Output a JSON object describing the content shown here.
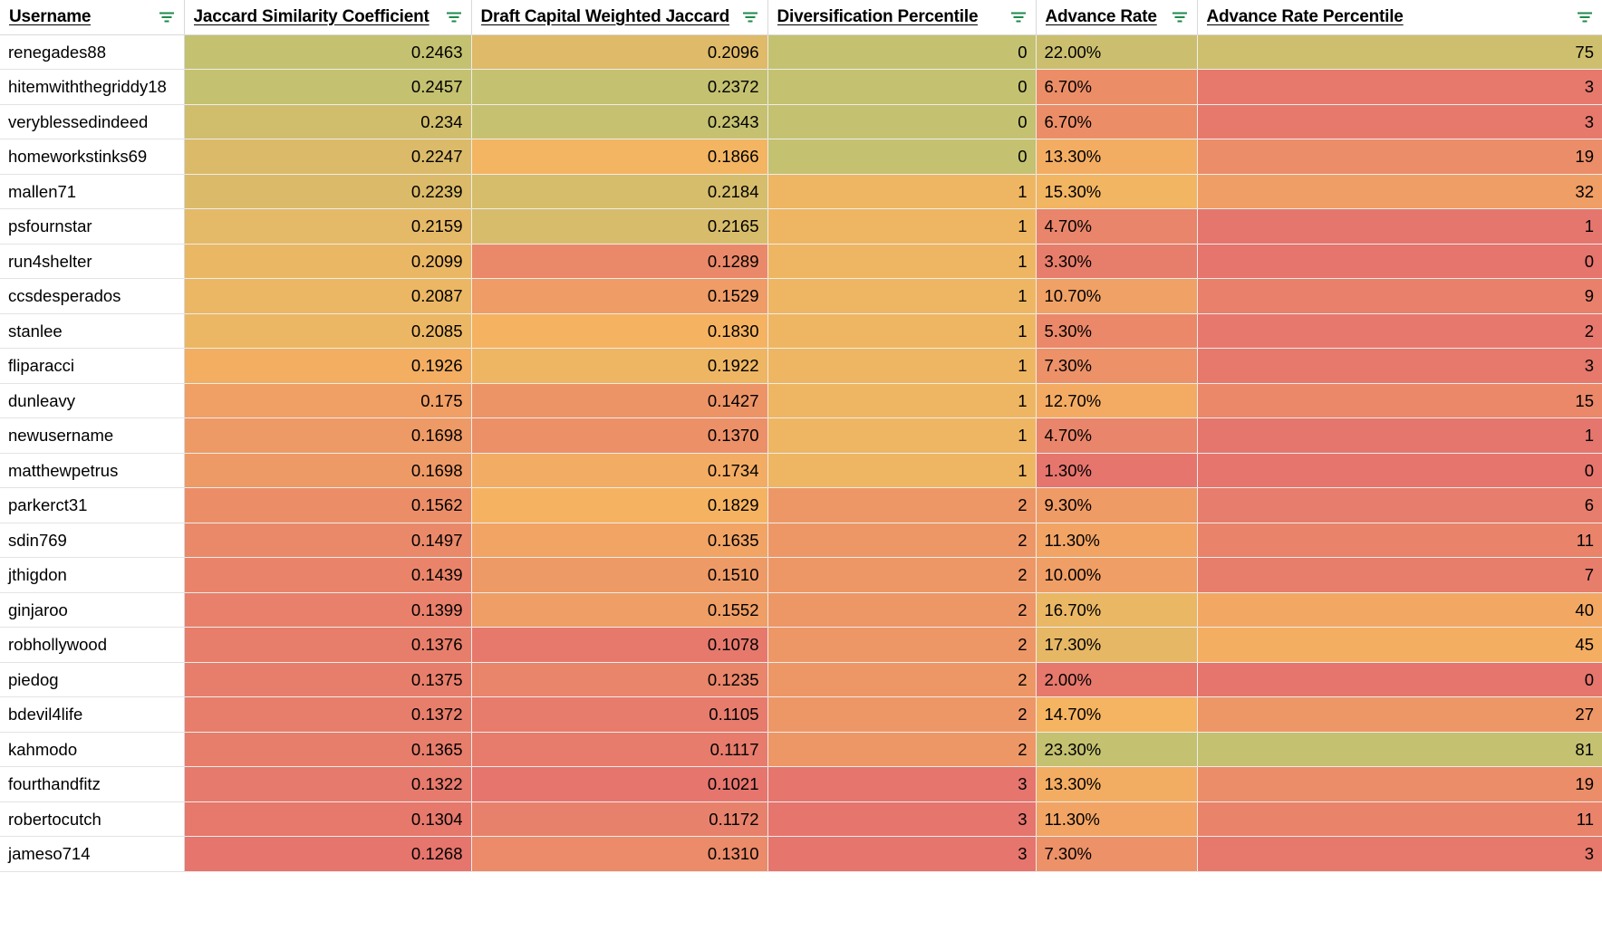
{
  "table": {
    "columns": [
      {
        "key": "username",
        "label": "Username",
        "align": "left",
        "icon": "filter-icon"
      },
      {
        "key": "jaccard",
        "label": "Jaccard Similarity Coefficient",
        "align": "right",
        "icon": "filter-icon"
      },
      {
        "key": "dcw",
        "label": "Draft Capital Weighted Jaccard",
        "align": "right",
        "icon": "filter-icon"
      },
      {
        "key": "divpct",
        "label": "Diversification Percentile",
        "align": "right",
        "icon": "filter-icon"
      },
      {
        "key": "advrate",
        "label": "Advance Rate",
        "align": "left",
        "icon": "filter-icon"
      },
      {
        "key": "advpct",
        "label": "Advance Rate Percentile",
        "align": "right",
        "icon": "filter-icon"
      }
    ],
    "rows": [
      {
        "username": "renegades88",
        "jaccard": "0.2463",
        "dcw": "0.2096",
        "divpct": "0",
        "advrate": "22.00%",
        "advpct": "75"
      },
      {
        "username": "hitemwiththegriddy18",
        "jaccard": "0.2457",
        "dcw": "0.2372",
        "divpct": "0",
        "advrate": "6.70%",
        "advpct": "3"
      },
      {
        "username": "veryblessedindeed",
        "jaccard": "0.234",
        "dcw": "0.2343",
        "divpct": "0",
        "advrate": "6.70%",
        "advpct": "3"
      },
      {
        "username": "homeworkstinks69",
        "jaccard": "0.2247",
        "dcw": "0.1866",
        "divpct": "0",
        "advrate": "13.30%",
        "advpct": "19"
      },
      {
        "username": "mallen71",
        "jaccard": "0.2239",
        "dcw": "0.2184",
        "divpct": "1",
        "advrate": "15.30%",
        "advpct": "32"
      },
      {
        "username": "psfournstar",
        "jaccard": "0.2159",
        "dcw": "0.2165",
        "divpct": "1",
        "advrate": "4.70%",
        "advpct": "1"
      },
      {
        "username": "run4shelter",
        "jaccard": "0.2099",
        "dcw": "0.1289",
        "divpct": "1",
        "advrate": "3.30%",
        "advpct": "0"
      },
      {
        "username": "ccsdesperados",
        "jaccard": "0.2087",
        "dcw": "0.1529",
        "divpct": "1",
        "advrate": "10.70%",
        "advpct": "9"
      },
      {
        "username": "stanlee",
        "jaccard": "0.2085",
        "dcw": "0.1830",
        "divpct": "1",
        "advrate": "5.30%",
        "advpct": "2"
      },
      {
        "username": "fliparacci",
        "jaccard": "0.1926",
        "dcw": "0.1922",
        "divpct": "1",
        "advrate": "7.30%",
        "advpct": "3"
      },
      {
        "username": "dunleavy",
        "jaccard": "0.175",
        "dcw": "0.1427",
        "divpct": "1",
        "advrate": "12.70%",
        "advpct": "15"
      },
      {
        "username": "newusername",
        "jaccard": "0.1698",
        "dcw": "0.1370",
        "divpct": "1",
        "advrate": "4.70%",
        "advpct": "1"
      },
      {
        "username": "matthewpetrus",
        "jaccard": "0.1698",
        "dcw": "0.1734",
        "divpct": "1",
        "advrate": "1.30%",
        "advpct": "0"
      },
      {
        "username": "parkerct31",
        "jaccard": "0.1562",
        "dcw": "0.1829",
        "divpct": "2",
        "advrate": "9.30%",
        "advpct": "6"
      },
      {
        "username": "sdin769",
        "jaccard": "0.1497",
        "dcw": "0.1635",
        "divpct": "2",
        "advrate": "11.30%",
        "advpct": "11"
      },
      {
        "username": "jthigdon",
        "jaccard": "0.1439",
        "dcw": "0.1510",
        "divpct": "2",
        "advrate": "10.00%",
        "advpct": "7"
      },
      {
        "username": "ginjaroo",
        "jaccard": "0.1399",
        "dcw": "0.1552",
        "divpct": "2",
        "advrate": "16.70%",
        "advpct": "40"
      },
      {
        "username": "robhollywood",
        "jaccard": "0.1376",
        "dcw": "0.1078",
        "divpct": "2",
        "advrate": "17.30%",
        "advpct": "45"
      },
      {
        "username": "piedog",
        "jaccard": "0.1375",
        "dcw": "0.1235",
        "divpct": "2",
        "advrate": "2.00%",
        "advpct": "0"
      },
      {
        "username": "bdevil4life",
        "jaccard": "0.1372",
        "dcw": "0.1105",
        "divpct": "2",
        "advrate": "14.70%",
        "advpct": "27"
      },
      {
        "username": "kahmodo",
        "jaccard": "0.1365",
        "dcw": "0.1117",
        "divpct": "2",
        "advrate": "23.30%",
        "advpct": "81"
      },
      {
        "username": "fourthandfitz",
        "jaccard": "0.1322",
        "dcw": "0.1021",
        "divpct": "3",
        "advrate": "13.30%",
        "advpct": "19"
      },
      {
        "username": "robertocutch",
        "jaccard": "0.1304",
        "dcw": "0.1172",
        "divpct": "3",
        "advrate": "11.30%",
        "advpct": "11"
      },
      {
        "username": "jameso714",
        "jaccard": "0.1268",
        "dcw": "0.1310",
        "divpct": "3",
        "advrate": "7.30%",
        "advpct": "3"
      }
    ]
  },
  "colors": {
    "scale_low": "#e5756d",
    "scale_mid": "#f5b461",
    "scale_high": "#a8c97a",
    "accent_filter_icon": "#1e8a4c",
    "header_background": "#ffffff",
    "username_background": "#ffffff",
    "grid_line": "#d9d9d9",
    "text": "#000000"
  },
  "heatmap": {
    "jaccard": {
      "min": 0.1268,
      "max": 0.2463
    },
    "dcw": {
      "min": 0.1021,
      "max": 0.2372
    },
    "divpct": {
      "min": 0,
      "max": 3
    },
    "advrate": {
      "min": 1.3,
      "max": 23.3
    },
    "advpct": {
      "min": 0,
      "max": 81
    }
  }
}
